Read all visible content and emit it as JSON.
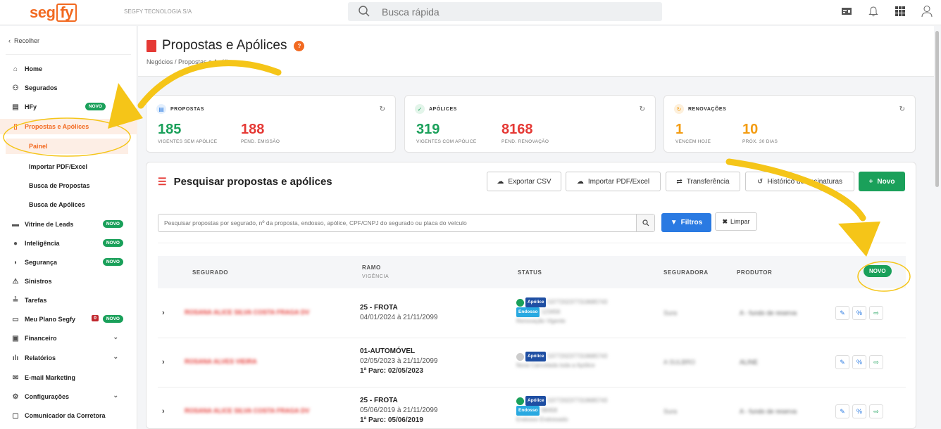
{
  "app": {
    "logo_prefix": "seg",
    "logo_suffix": "fy",
    "company": "SEGFY TECNOLOGIA S/A",
    "search_placeholder": "Busca rápida"
  },
  "icons": {
    "search": "search-icon",
    "calculator": "calculator-icon",
    "bell": "bell-icon",
    "apps": "apps-grid-icon",
    "user": "user-icon"
  },
  "sidebar": {
    "collapse_label": "Recolher",
    "items": [
      {
        "label": "Home",
        "icon": "home-icon"
      },
      {
        "label": "Segurados",
        "icon": "users-icon"
      },
      {
        "label": "HFy",
        "icon": "clipboard-icon",
        "badge": "NOVO"
      },
      {
        "label": "Propostas e Apólices",
        "icon": "document-icon"
      },
      {
        "label": "Painel"
      },
      {
        "label": "Importar PDF/Excel"
      },
      {
        "label": "Busca de Propostas"
      },
      {
        "label": "Busca de Apólices"
      },
      {
        "label": "Vitrine de Leads",
        "icon": "storefront-icon",
        "badge": "NOVO"
      },
      {
        "label": "Inteligência",
        "icon": "brain-icon",
        "badge": "NOVO"
      },
      {
        "label": "Segurança",
        "icon": "shield-icon",
        "badge": "NOVO"
      },
      {
        "label": "Sinistros",
        "icon": "warning-icon"
      },
      {
        "label": "Tarefas",
        "icon": "tasks-icon"
      },
      {
        "label": "Meu Plano Segfy",
        "icon": "plan-icon",
        "count": "0",
        "badge": "NOVO"
      },
      {
        "label": "Financeiro",
        "icon": "money-icon"
      },
      {
        "label": "Relatórios",
        "icon": "chart-icon"
      },
      {
        "label": "E-mail Marketing",
        "icon": "mail-icon"
      },
      {
        "label": "Configurações",
        "icon": "gear-icon"
      },
      {
        "label": "Comunicador da Corretora",
        "icon": "chat-icon"
      }
    ]
  },
  "page": {
    "title": "Propostas e Apólices",
    "help": "?",
    "breadcrumb": "Negócios  /  Propostas e Apólices"
  },
  "cards": {
    "propostas": {
      "title": "PROPOSTAS",
      "v1": "185",
      "l1": "VIGENTES SEM APÓLICE",
      "v2": "188",
      "l2": "PEND. EMISSÃO"
    },
    "apolices": {
      "title": "APÓLICES",
      "v1": "319",
      "l1": "VIGENTES COM APÓLICE",
      "v2": "8168",
      "l2": "PEND. RENOVAÇÃO"
    },
    "renovacoes": {
      "title": "RENOVAÇÕES",
      "v1": "1",
      "l1": "VENCEM HOJE",
      "v2": "10",
      "l2": "PRÓX. 30 DIAS"
    }
  },
  "panel": {
    "title": "Pesquisar propostas e apólices",
    "buttons": {
      "export": "Exportar CSV",
      "import": "Importar PDF/Excel",
      "transfer": "Transferência",
      "history": "Histórico de assinaturas",
      "new": "Novo"
    },
    "search_placeholder": "Pesquisar propostas por segurado, nº da proposta, endosso, apólice, CPF/CNPJ do segurado ou placa do veículo",
    "filters": "Filtros",
    "clear": "Limpar"
  },
  "table": {
    "headers": {
      "segurado": "SEGURADO",
      "ramo": "RAMO",
      "vigencia": "VIGÊNCIA",
      "status": "STATUS",
      "seguradora": "SEGURADORA",
      "produtor": "PRODUTOR",
      "novo": "NOVO"
    },
    "rows": [
      {
        "segurado": "ROSANA ALICE SILVA COSTA FRAGA DV",
        "ramo": "25 - FROTA",
        "vigencia": "04/01/2024 à 21/11/2099",
        "parcela": "",
        "status_tag": "Apólice",
        "status_no": "5377202377319685743",
        "endosso_tag": "Endosso",
        "endosso_no": "123456",
        "status_text": "Renovação Vigente",
        "seguradora": "Sura",
        "produtor": "A - fundo de reserva",
        "dot_color": "#1aa05a"
      },
      {
        "segurado": "ROSANA ALVES VIEIRA",
        "ramo": "01-AUTOMÓVEL",
        "vigencia": "02/05/2023 à 21/11/2099",
        "parcela": "1ª Parc: 02/05/2023",
        "status_tag": "Apólice",
        "status_no": "5377202377319685743",
        "endosso_tag": "",
        "endosso_no": "",
        "status_text": "Nova Cancelada toda a Apólice",
        "seguradora": "A SULBRO",
        "produtor": "ALINE",
        "dot_color": "#cccccc"
      },
      {
        "segurado": "ROSANA ALICE SILVA COSTA FRAGA DV",
        "ramo": "25 - FROTA",
        "vigencia": "05/06/2019 à 21/11/2099",
        "parcela": "1ª Parc: 05/06/2019",
        "status_tag": "Apólice",
        "status_no": "5377202377319685743",
        "endosso_tag": "Endosso",
        "endosso_no": "98458",
        "status_text": "Endosso Endossado",
        "seguradora": "Sura",
        "produtor": "A - fundo de reserva",
        "dot_color": "#1aa05a"
      }
    ]
  },
  "colors": {
    "brand": "#f26a21",
    "green": "#1aa05a",
    "red": "#e53935",
    "blue": "#2a7ae2",
    "arrow": "#f5c518"
  }
}
